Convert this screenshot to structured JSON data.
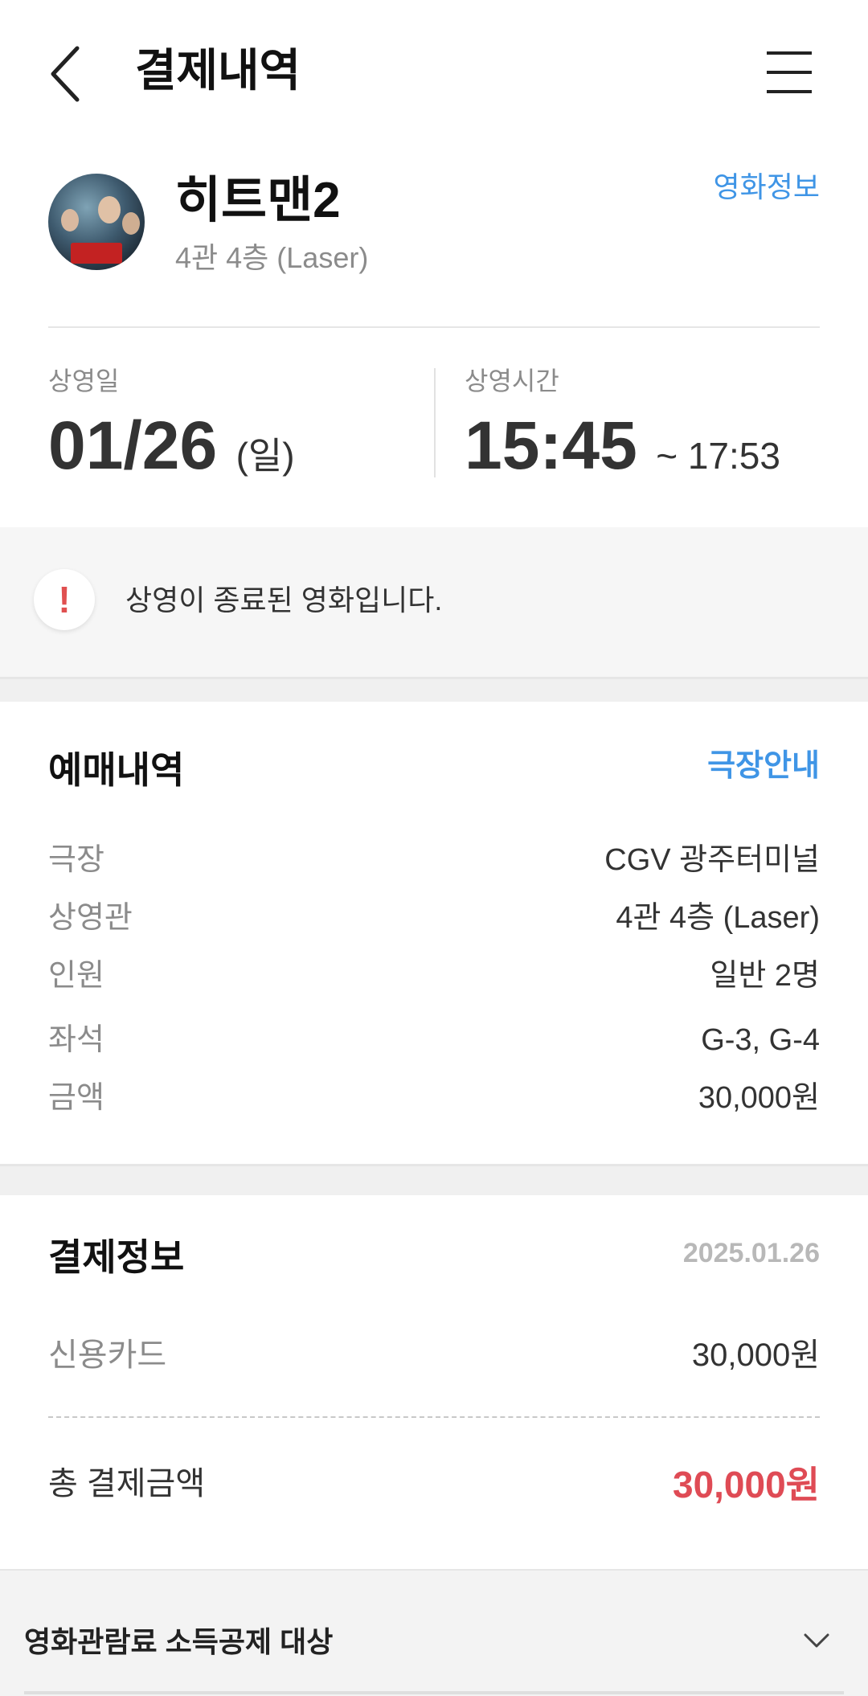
{
  "header": {
    "title": "결제내역",
    "back_icon": "chevron-left-icon",
    "menu_icon": "hamburger-menu-icon"
  },
  "movie": {
    "title": "히트맨2",
    "hall": "4관 4층 (Laser)",
    "info_link": "영화정보"
  },
  "schedule": {
    "date_label": "상영일",
    "date": "01/26",
    "day": "(일)",
    "time_label": "상영시간",
    "start": "15:45",
    "end": "~ 17:53"
  },
  "notice": {
    "icon": "!",
    "text": "상영이 종료된 영화입니다."
  },
  "booking": {
    "title": "예매내역",
    "theater_link": "극장안내",
    "rows": [
      {
        "label": "극장",
        "value": "CGV 광주터미널"
      },
      {
        "label": "상영관",
        "value": "4관 4층 (Laser)"
      },
      {
        "label": "인원",
        "value": "일반 2명"
      },
      {
        "label": "좌석",
        "value": "G-3, G-4"
      },
      {
        "label": "금액",
        "value": "30,000원"
      }
    ]
  },
  "payment": {
    "title": "결제정보",
    "date": "2025.01.26",
    "method_label": "신용카드",
    "method_amount": "30,000원",
    "total_label": "총 결제금액",
    "total_amount": "30,000원"
  },
  "deduction": {
    "label": "영화관람료 소득공제 대상",
    "icon": "chevron-down-icon"
  },
  "colors": {
    "accent_blue": "#3f95e6",
    "total_red": "#df4b55",
    "notice_red": "#e05050"
  }
}
